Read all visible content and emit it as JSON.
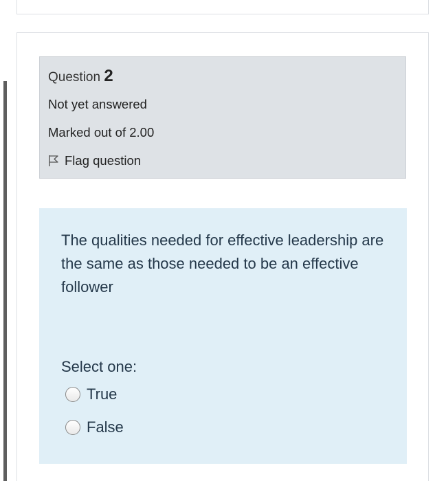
{
  "question": {
    "label": "Question",
    "number": "2",
    "state": "Not yet answered",
    "grade": "Marked out of 2.00",
    "flag_label": "Flag question"
  },
  "content": {
    "text": "The qualities needed for effective leadership are the same as those needed to be an effective follower",
    "prompt": "Select one:",
    "options": [
      {
        "label": "True"
      },
      {
        "label": "False"
      }
    ]
  },
  "icons": {
    "flag": "flag-icon",
    "radio": "radio-icon"
  },
  "colors": {
    "info_bg": "#dee2e6",
    "content_bg": "#e0eff7",
    "text": "#24384a"
  }
}
